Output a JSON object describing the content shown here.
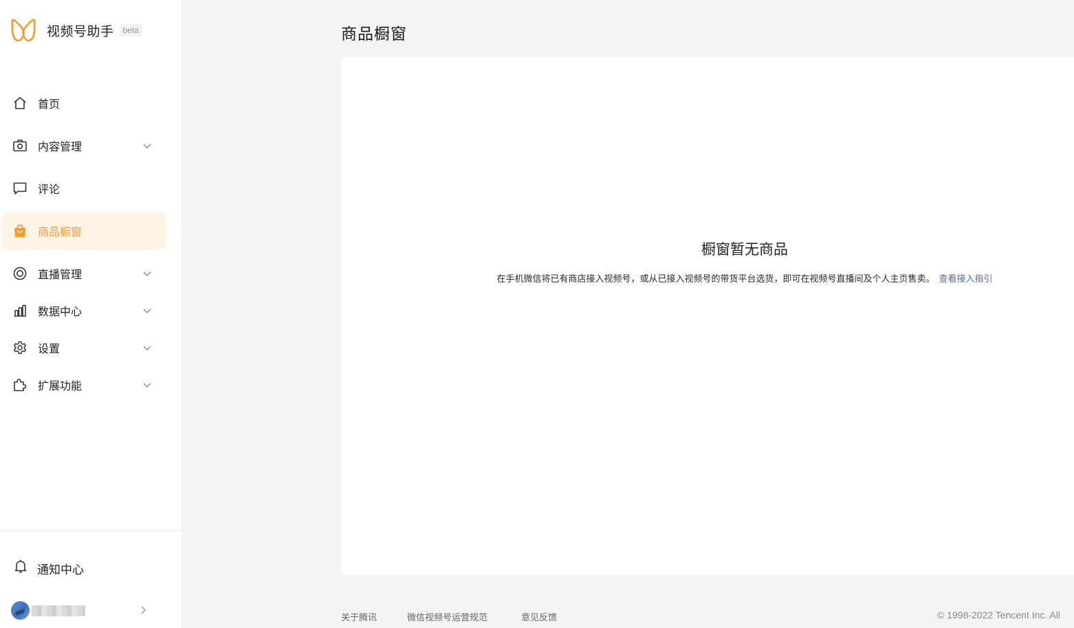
{
  "brand": {
    "name": "视频号助手",
    "badge": "beta",
    "logo_color": "#f79a2b"
  },
  "sidebar": {
    "items": [
      {
        "label": "首页",
        "icon": "home-icon",
        "expandable": false,
        "active": false
      },
      {
        "label": "内容管理",
        "icon": "camera-icon",
        "expandable": true,
        "active": false
      },
      {
        "label": "评论",
        "icon": "comment-icon",
        "expandable": false,
        "active": false
      },
      {
        "label": "商品橱窗",
        "icon": "shopping-bag-icon",
        "expandable": false,
        "active": true
      },
      {
        "label": "直播管理",
        "icon": "live-icon",
        "expandable": true,
        "active": false
      },
      {
        "label": "数据中心",
        "icon": "bar-chart-icon",
        "expandable": true,
        "active": false
      },
      {
        "label": "设置",
        "icon": "gear-icon",
        "expandable": true,
        "active": false
      },
      {
        "label": "扩展功能",
        "icon": "puzzle-icon",
        "expandable": true,
        "active": false
      }
    ],
    "notify_label": "通知中心",
    "active_color": "#f79a2b",
    "active_bg": "#fff4e6"
  },
  "main": {
    "title": "商品橱窗",
    "empty_title": "橱窗暂无商品",
    "empty_desc": "在手机微信将已有商店接入视频号，或从已接入视频号的带货平台选货，即可在视频号直播间及个人主页售卖。",
    "empty_link": "查看接入指引",
    "link_color": "#576b95"
  },
  "footer": {
    "links": [
      "关于腾讯",
      "微信视频号运营规范",
      "意见反馈"
    ],
    "copyright": "© 1998-2022 Tencent Inc. All"
  }
}
